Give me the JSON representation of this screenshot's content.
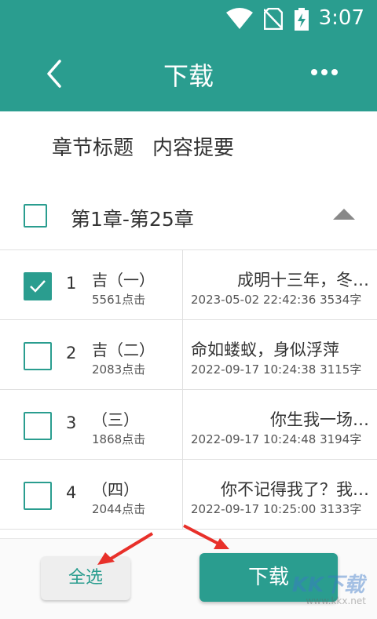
{
  "status_bar": {
    "time": "3:07"
  },
  "app_bar": {
    "title": "下载"
  },
  "tabs": [
    "章节标题",
    "内容提要"
  ],
  "section": {
    "label": "第1章-第25章"
  },
  "rows": [
    {
      "num": "1",
      "title": "吉（一）",
      "clicks": "5561点击",
      "excerpt": "成明十三年，冬…",
      "meta": "2023-05-02 22:42:36  3534字",
      "checked": true
    },
    {
      "num": "2",
      "title": "吉（二）",
      "clicks": "2083点击",
      "excerpt": "命如蝼蚁，身似浮萍",
      "meta": "2022-09-17 10:24:38  3115字",
      "checked": false
    },
    {
      "num": "3",
      "title": "（三）",
      "clicks": "1868点击",
      "excerpt": "你生我一场…",
      "meta": "2022-09-17 10:24:48  3194字",
      "checked": false
    },
    {
      "num": "4",
      "title": "（四）",
      "clicks": "2044点击",
      "excerpt": "你不记得我了？我…",
      "meta": "2022-09-17 10:25:00  3133字",
      "checked": false
    }
  ],
  "bottom": {
    "select_all": "全选",
    "download": "下载"
  },
  "watermark": {
    "logo": "KK下载",
    "url": "www.kkx.net"
  },
  "colors": {
    "accent": "#2a9d8f",
    "annotation_arrow": "#e8302a"
  }
}
